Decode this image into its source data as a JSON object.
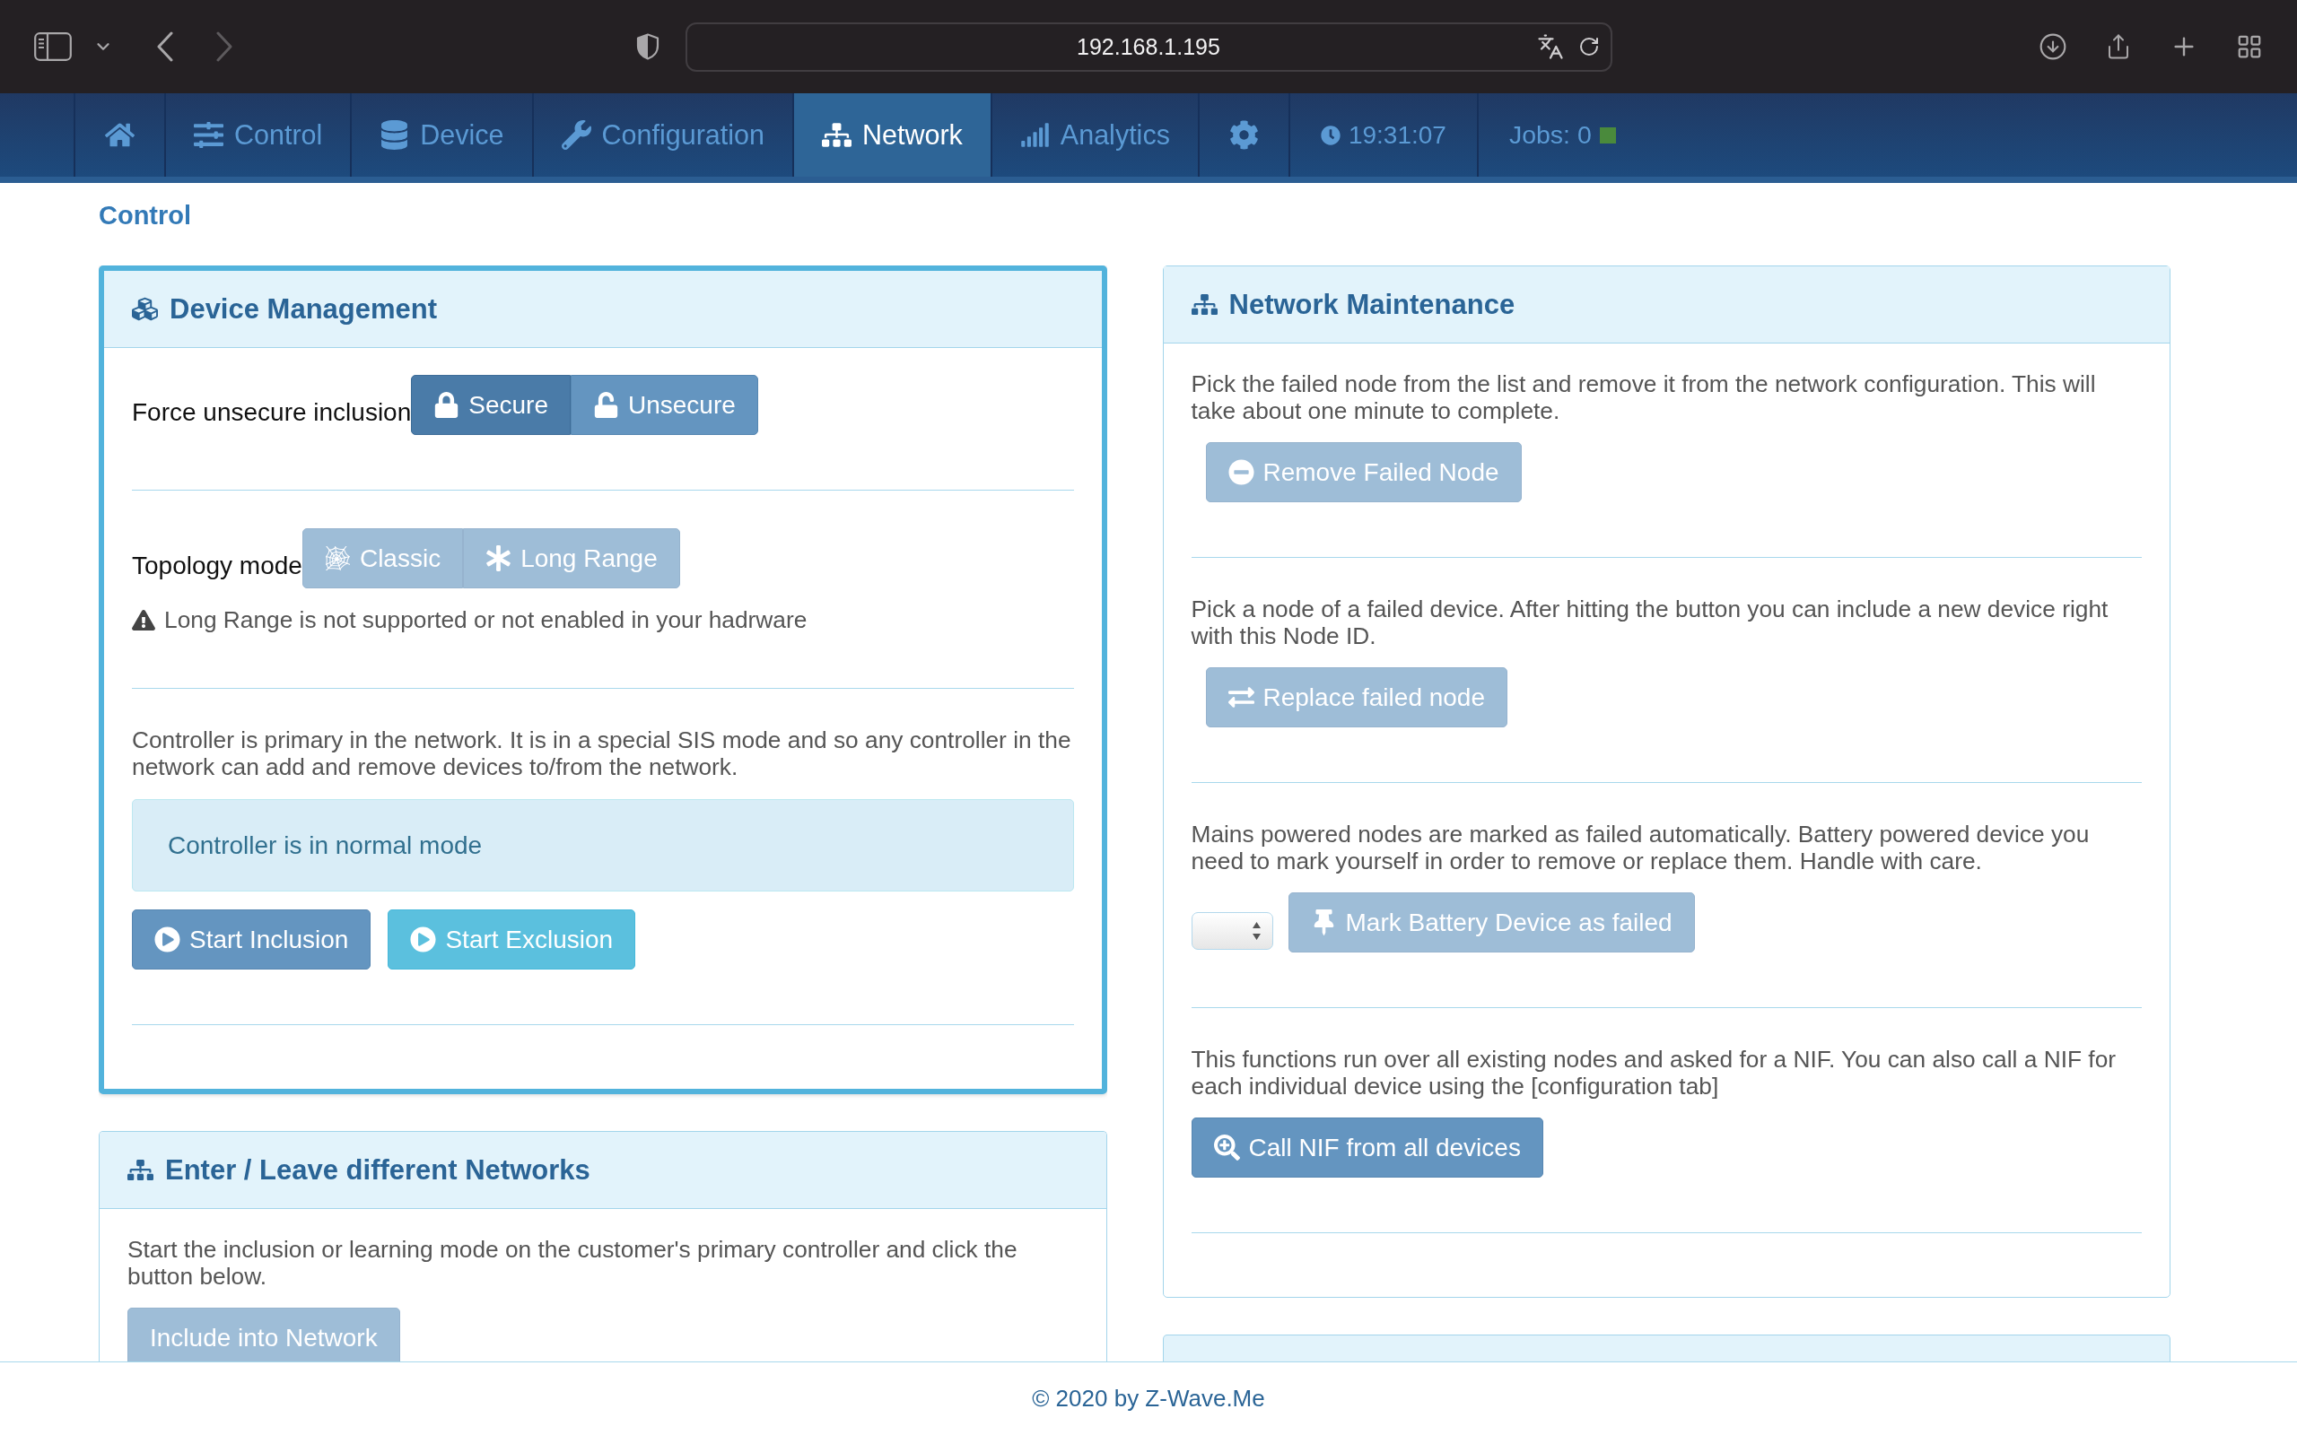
{
  "browser": {
    "url": "192.168.1.195",
    "nav_buttons": [
      {
        "kind": "back",
        "disabled": false
      },
      {
        "kind": "forward",
        "disabled": true
      }
    ]
  },
  "nav": {
    "items": [
      {
        "kind": "home",
        "selected": false
      },
      {
        "kind": "control",
        "label": "Control",
        "selected": false
      },
      {
        "kind": "device",
        "label": "Device",
        "selected": false
      },
      {
        "kind": "configuration",
        "label": "Configuration",
        "selected": false
      },
      {
        "kind": "network",
        "label": "Network",
        "selected": true
      },
      {
        "kind": "analytics",
        "label": "Analytics",
        "selected": false
      },
      {
        "kind": "settings",
        "selected": false
      }
    ],
    "clock": {
      "time": "19:31:07"
    },
    "jobs": {
      "label": "Jobs: 0",
      "color": "#4a8a3c"
    }
  },
  "page_title": "Control",
  "columns": [
    [
      {
        "kind": "device_management",
        "title": "Device Management",
        "highlighted": true,
        "sections": [
          {
            "kind": "toggle",
            "label": "Force unsecure inclusion",
            "options": [
              {
                "kind": "secure",
                "label": "Secure",
                "selected": true,
                "disabled": false
              },
              {
                "kind": "unsecure",
                "label": "Unsecure",
                "selected": false,
                "disabled": false
              }
            ]
          },
          {
            "kind": "toggle",
            "label": "Topology mode",
            "options": [
              {
                "kind": "classic",
                "label": "Classic",
                "selected": false,
                "disabled": true
              },
              {
                "kind": "long_range",
                "label": "Long Range",
                "selected": false,
                "disabled": true
              }
            ],
            "warning": "Long Range is not supported or not enabled in your hadrware"
          },
          {
            "kind": "status",
            "text": "Controller is primary in the network. It is in a special SIS mode and so any controller in the network can add and remove devices to/from the network.",
            "alert": "Controller is in normal mode",
            "buttons": [
              {
                "kind": "start_inclusion",
                "label": "Start Inclusion",
                "disabled": false
              },
              {
                "kind": "start_exclusion",
                "label": "Start Exclusion",
                "disabled": false
              }
            ]
          }
        ]
      },
      {
        "kind": "networks",
        "title": "Enter / Leave different Networks",
        "highlighted": false,
        "sections": [
          {
            "kind": "action",
            "text": "Start the inclusion or learning mode on the customer's primary controller and click the button below.",
            "buttons": [
              {
                "kind": "include",
                "label": "Include into Network",
                "disabled": true
              }
            ]
          }
        ]
      }
    ],
    [
      {
        "kind": "network_maintenance",
        "title": "Network Maintenance",
        "highlighted": false,
        "sections": [
          {
            "kind": "node_action",
            "text": "Pick the failed node from the list and remove it from the network configuration. This will take about one minute to complete.",
            "buttons": [
              {
                "kind": "remove",
                "label": "Remove Failed Node",
                "disabled": true
              }
            ]
          },
          {
            "kind": "node_action",
            "text": "Pick a node of a failed device. After hitting the button you can include a new device right with this Node ID.",
            "buttons": [
              {
                "kind": "replace",
                "label": "Replace failed node",
                "disabled": true
              }
            ]
          },
          {
            "kind": "select_action",
            "text": "Mains powered nodes are marked as failed automatically. Battery powered device you need to mark yourself in order to remove or replace them. Handle with care.",
            "buttons": [
              {
                "kind": "mark_failed",
                "label": "Mark Battery Device as failed",
                "disabled": true
              }
            ]
          },
          {
            "kind": "action",
            "text": "This functions run over all existing nodes and asked for a NIF. You can also call a NIF for each individual device using the [configuration tab]",
            "buttons": [
              {
                "kind": "call_nif",
                "label": "Call NIF from all devices",
                "disabled": false
              }
            ]
          }
        ]
      },
      {
        "kind": "partial"
      }
    ]
  ],
  "footer": "© 2020 by Z-Wave.Me"
}
